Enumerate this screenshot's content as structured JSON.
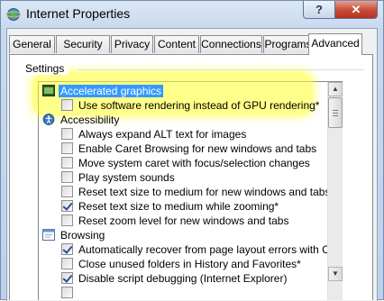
{
  "window": {
    "title": "Internet Properties",
    "help_label": "?",
    "close_label": "✕"
  },
  "tabs": [
    {
      "label": "General"
    },
    {
      "label": "Security"
    },
    {
      "label": "Privacy"
    },
    {
      "label": "Content"
    },
    {
      "label": "Connections"
    },
    {
      "label": "Programs"
    },
    {
      "label": "Advanced",
      "active": true
    }
  ],
  "settings": {
    "group_label": "Settings",
    "categories": {
      "accelerated_graphics": "Accelerated graphics",
      "accessibility": "Accessibility",
      "browsing": "Browsing"
    },
    "options": {
      "use_software_rendering": {
        "label": "Use software rendering instead of GPU rendering*",
        "checked": false
      },
      "always_expand_alt": {
        "label": "Always expand ALT text for images",
        "checked": false
      },
      "caret_browsing": {
        "label": "Enable Caret Browsing for new windows and tabs",
        "checked": false
      },
      "move_caret": {
        "label": "Move system caret with focus/selection changes",
        "checked": false
      },
      "play_system_sounds": {
        "label": "Play system sounds",
        "checked": false
      },
      "reset_text_size_new": {
        "label": "Reset text size to medium for new windows and tabs",
        "checked": false
      },
      "reset_text_size_zoom": {
        "label": "Reset text size to medium while zooming*",
        "checked": true
      },
      "reset_zoom_level": {
        "label": "Reset zoom level for new windows and tabs",
        "checked": false
      },
      "auto_recover": {
        "label": "Automatically recover from page layout errors with Compa",
        "checked": true
      },
      "close_unused_folders": {
        "label": "Close unused folders in History and Favorites*",
        "checked": false
      },
      "disable_script_debugging": {
        "label": "Disable script debugging (Internet Explorer)",
        "checked": true
      }
    }
  },
  "colors": {
    "highlight": "#ffff28",
    "selection": "#3399ff",
    "close_button": "#c74a36"
  }
}
